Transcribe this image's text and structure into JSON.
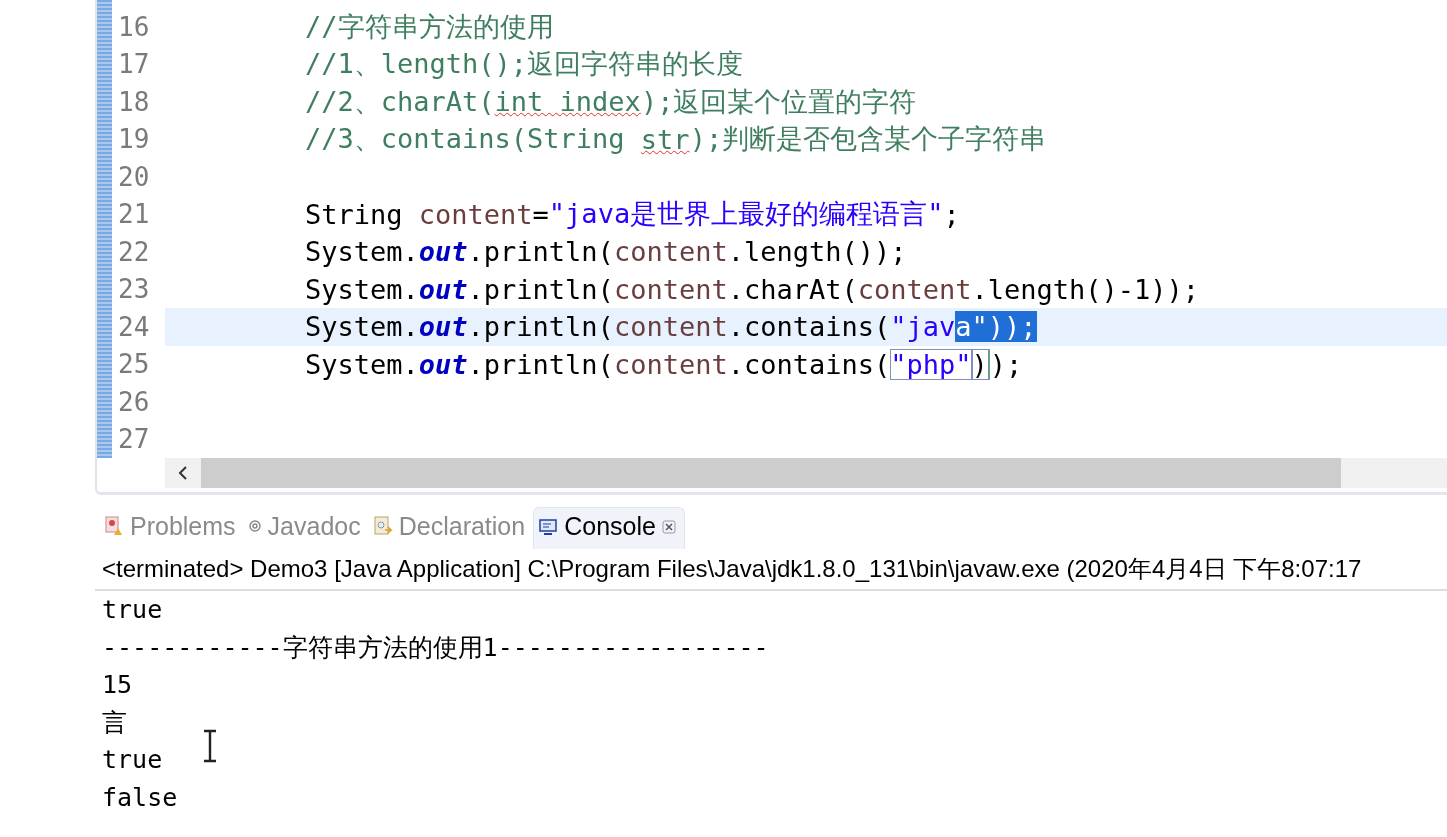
{
  "editor": {
    "lines": [
      {
        "number": "16",
        "current": false,
        "tokens": [
          {
            "kind": "comment",
            "text": "//字符串方法的使用",
            "selected": false
          }
        ]
      },
      {
        "number": "17",
        "current": false,
        "tokens": [
          {
            "kind": "comment",
            "text": "//1、length();返回字符串的长度",
            "selected": false
          }
        ]
      },
      {
        "number": "18",
        "current": false,
        "tokens": [
          {
            "kind": "comment",
            "text": "//2、charAt(",
            "selected": false
          },
          {
            "kind": "comment_misspelled",
            "text": "int index",
            "selected": false
          },
          {
            "kind": "comment",
            "text": ");返回某个位置的字符",
            "selected": false
          }
        ]
      },
      {
        "number": "19",
        "current": false,
        "tokens": [
          {
            "kind": "comment",
            "text": "//3、contains(String ",
            "selected": false
          },
          {
            "kind": "comment_misspelled",
            "text": "str",
            "selected": false
          },
          {
            "kind": "comment",
            "text": ");判断是否包含某个子字符串",
            "selected": false
          }
        ]
      },
      {
        "number": "20",
        "current": false
      },
      {
        "number": "21",
        "current": false,
        "tokens": [
          {
            "kind": "plain",
            "text": "String ",
            "selected": false
          },
          {
            "kind": "var",
            "text": "content",
            "selected": false
          },
          {
            "kind": "plain",
            "text": "=",
            "selected": false
          },
          {
            "kind": "string",
            "text": "\"java是世界上最好的编程语言\"",
            "selected": false
          },
          {
            "kind": "plain",
            "text": ";",
            "selected": false
          }
        ]
      },
      {
        "number": "22",
        "current": false,
        "tokens": [
          {
            "kind": "plain",
            "text": "System.",
            "selected": false
          },
          {
            "kind": "field",
            "text": "out",
            "selected": false
          },
          {
            "kind": "plain",
            "text": ".println(",
            "selected": false
          },
          {
            "kind": "var",
            "text": "content",
            "selected": false
          },
          {
            "kind": "plain",
            "text": ".length());",
            "selected": false
          }
        ]
      },
      {
        "number": "23",
        "current": false,
        "tokens": [
          {
            "kind": "plain",
            "text": "System.",
            "selected": false
          },
          {
            "kind": "field",
            "text": "out",
            "selected": false
          },
          {
            "kind": "plain",
            "text": ".println(",
            "selected": false
          },
          {
            "kind": "var",
            "text": "content",
            "selected": false
          },
          {
            "kind": "plain",
            "text": ".charAt(",
            "selected": false
          },
          {
            "kind": "var",
            "text": "content",
            "selected": false
          },
          {
            "kind": "plain",
            "text": ".length()-1));",
            "selected": false
          }
        ]
      },
      {
        "number": "24",
        "current": true,
        "tokens": [
          {
            "kind": "plain",
            "text": "System.",
            "selected": false
          },
          {
            "kind": "field",
            "text": "out",
            "selected": false
          },
          {
            "kind": "plain",
            "text": ".println(",
            "selected": false
          },
          {
            "kind": "var",
            "text": "content",
            "selected": false
          },
          {
            "kind": "plain",
            "text": ".contains(",
            "selected": false
          },
          {
            "kind": "string",
            "text": "\"jav",
            "selected": false
          },
          {
            "kind": "string",
            "text": "a\"",
            "selected": true
          },
          {
            "kind": "plain",
            "text": "));",
            "selected": true
          }
        ]
      },
      {
        "number": "25",
        "current": false,
        "tokens": [
          {
            "kind": "plain",
            "text": "System.",
            "selected": false
          },
          {
            "kind": "field",
            "text": "out",
            "selected": false
          },
          {
            "kind": "plain",
            "text": ".println(",
            "selected": false
          },
          {
            "kind": "var",
            "text": "content",
            "selected": false
          },
          {
            "kind": "plain",
            "text": ".contains(",
            "selected": false
          },
          {
            "kind": "string_boxed",
            "text": "\"php\"",
            "selected": false
          },
          {
            "kind": "bracket_boxed",
            "text": ")",
            "selected": false
          },
          {
            "kind": "plain",
            "text": ");",
            "selected": false
          }
        ]
      },
      {
        "number": "26",
        "current": false
      },
      {
        "number": "27",
        "current": false
      }
    ]
  },
  "tabs": [
    {
      "label": "Problems",
      "selected": false
    },
    {
      "label": "Javadoc",
      "selected": false
    },
    {
      "label": "Declaration",
      "selected": false
    },
    {
      "label": "Console",
      "selected": true
    }
  ],
  "console": {
    "header": "<terminated> Demo3 [Java Application] C:\\Program Files\\Java\\jdk1.8.0_131\\bin\\javaw.exe (2020年4月4日 下午8:07:17",
    "output": [
      "true",
      "------------字符串方法的使用1------------------",
      "15",
      "言",
      "true",
      "false"
    ]
  }
}
